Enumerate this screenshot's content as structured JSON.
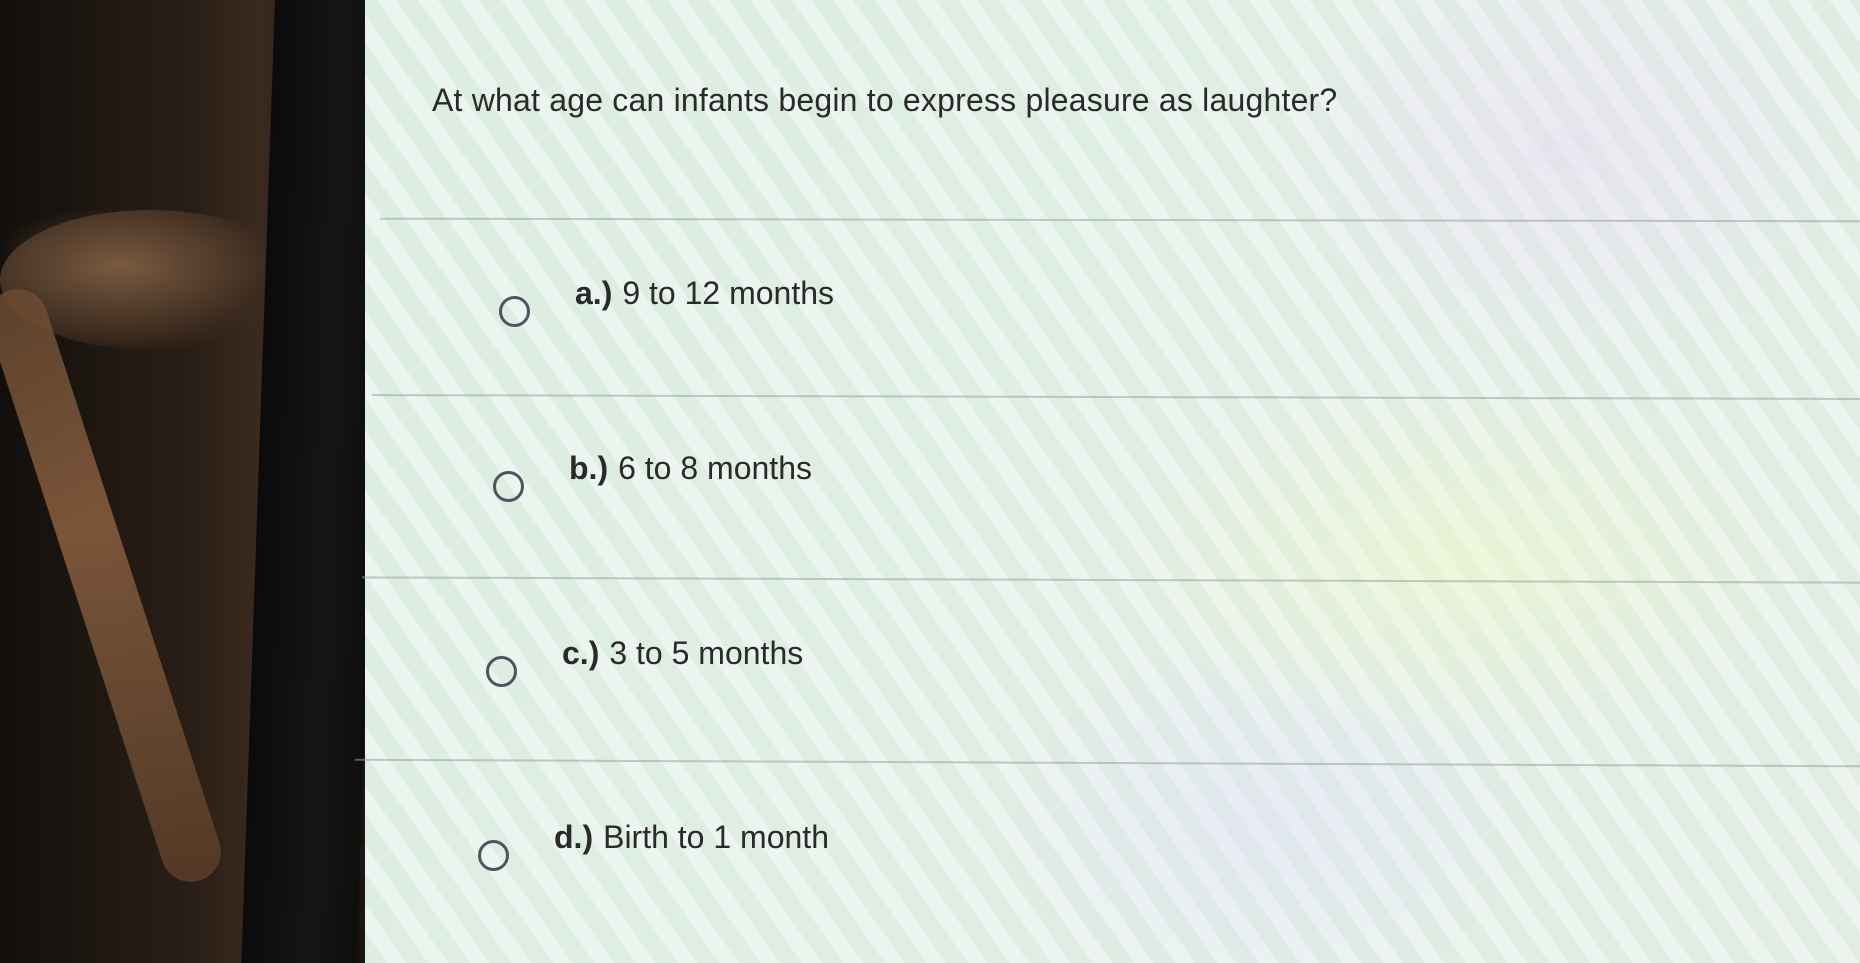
{
  "question": {
    "text": "At what age can infants begin to express pleasure as laughter?"
  },
  "options": [
    {
      "letter": "a.)",
      "label": "9 to 12 months",
      "selected": false
    },
    {
      "letter": "b.)",
      "label": "6 to 8 months",
      "selected": false
    },
    {
      "letter": "c.)",
      "label": "3 to 5 months",
      "selected": false
    },
    {
      "letter": "d.)",
      "label": "Birth to 1 month",
      "selected": false
    }
  ],
  "icons": {
    "option_marker": "radio-circle-icon"
  }
}
